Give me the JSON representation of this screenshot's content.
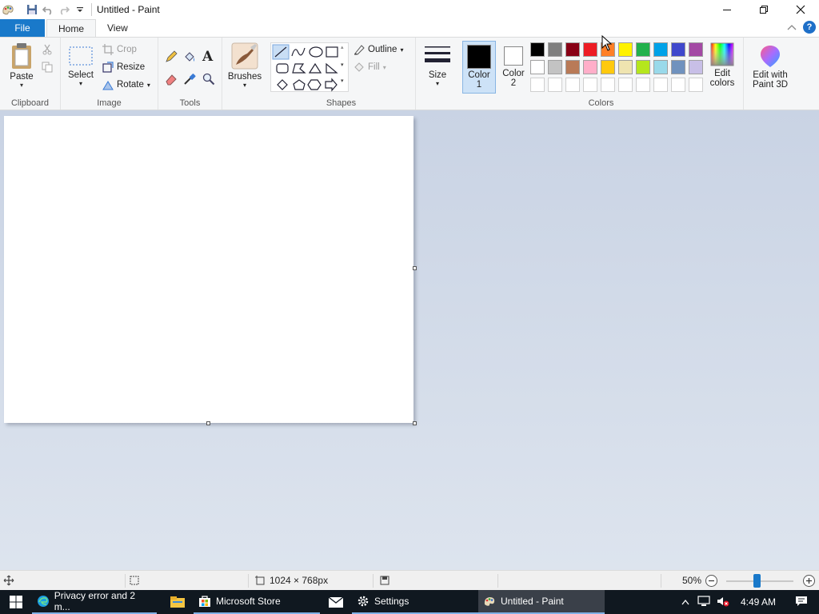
{
  "window": {
    "title": "Untitled - Paint"
  },
  "tabs": [
    {
      "label": "File"
    },
    {
      "label": "Home"
    },
    {
      "label": "View"
    }
  ],
  "ribbon": {
    "clipboard": {
      "paste": "Paste",
      "group": "Clipboard"
    },
    "image": {
      "select": "Select",
      "crop": "Crop",
      "resize": "Resize",
      "rotate": "Rotate",
      "group": "Image"
    },
    "tools": {
      "group": "Tools"
    },
    "brushes": {
      "label": "Brushes"
    },
    "shapes": {
      "outline": "Outline",
      "fill": "Fill",
      "group": "Shapes"
    },
    "size": {
      "label": "Size"
    },
    "colors": {
      "color1_line1": "Color",
      "color1_line2": "1",
      "color2_line1": "Color",
      "color2_line2": "2",
      "edit_line1": "Edit",
      "edit_line2": "colors",
      "group": "Colors",
      "row1": [
        "#000000",
        "#7f7f7f",
        "#880015",
        "#ed1c24",
        "#ff7f27",
        "#fff200",
        "#22b14c",
        "#00a2e8",
        "#3f48cc",
        "#a349a4"
      ],
      "row2": [
        "#ffffff",
        "#c3c3c3",
        "#b97a57",
        "#ffaec9",
        "#ffc90e",
        "#efe4b0",
        "#b5e61d",
        "#99d9ea",
        "#7092be",
        "#c8bfe7"
      ]
    },
    "paint3d": {
      "line1": "Edit with",
      "line2": "Paint 3D"
    }
  },
  "status": {
    "dimensions": "1024 × 768px",
    "zoom": "50%",
    "zoom_fraction": 0.45
  },
  "taskbar": {
    "items": [
      {
        "label": "Privacy error and 2 m..."
      },
      {
        "label": "Microsoft Store"
      },
      {
        "label": "Settings"
      },
      {
        "label": "Untitled - Paint"
      }
    ],
    "time": "4:49 AM"
  }
}
